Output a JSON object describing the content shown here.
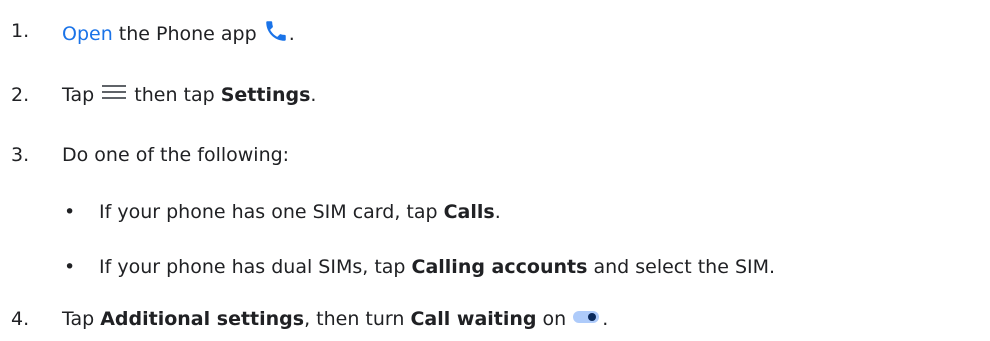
{
  "steps": [
    {
      "number": "1.",
      "link": "Open",
      "text_after_link": " the Phone app ",
      "trailing": ".",
      "icon": "phone-icon"
    },
    {
      "number": "2.",
      "text_before": "Tap ",
      "icon": "menu-icon",
      "text_mid": " then tap ",
      "bold": "Settings",
      "trailing": "."
    },
    {
      "number": "3.",
      "text": "Do one of the following:",
      "bullets": [
        {
          "text_before": "If your phone has one SIM card, tap ",
          "bold": "Calls",
          "trailing": "."
        },
        {
          "text_before": "If your phone has dual SIMs, tap ",
          "bold": "Calling accounts",
          "trailing": " and select the SIM."
        }
      ]
    },
    {
      "number": "4.",
      "text_before": "Tap ",
      "bold1": "Additional settings",
      "text_mid": ", then turn ",
      "bold2": "Call waiting",
      "text_after": " on ",
      "icon": "toggle-on-icon",
      "trailing": "."
    }
  ],
  "colors": {
    "link": "#1a73e8",
    "text": "#202124",
    "phone_icon": "#1a73e8",
    "toggle_track": "#aecbfa",
    "toggle_thumb": "#0b2a5b"
  }
}
